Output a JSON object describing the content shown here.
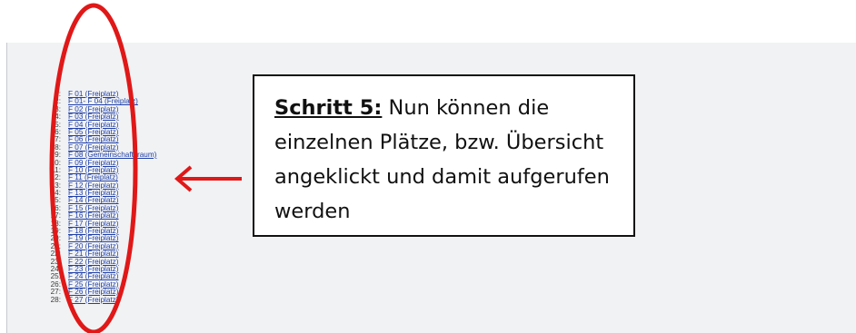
{
  "list": {
    "items": [
      {
        "num": "1:",
        "label": "F 01 (Freiplatz)"
      },
      {
        "num": "2:",
        "label": "F 01- F 04 (Freiplatz)"
      },
      {
        "num": "3:",
        "label": "F 02 (Freiplatz)"
      },
      {
        "num": "4:",
        "label": "F 03 (Freiplatz)"
      },
      {
        "num": "5:",
        "label": "F 04 (Freiplatz)"
      },
      {
        "num": "6:",
        "label": "F 05 (Freiplatz)"
      },
      {
        "num": "7:",
        "label": "F 06 (Freiplatz)"
      },
      {
        "num": "8:",
        "label": "F 07 (Freiplatz)"
      },
      {
        "num": "9:",
        "label": "F 08 (Gemeinschaftsraum)"
      },
      {
        "num": "10:",
        "label": "F 09 (Freiplatz)"
      },
      {
        "num": "11:",
        "label": "F 10 (Freiplatz)"
      },
      {
        "num": "12:",
        "label": "F 11 (Freiplatz)"
      },
      {
        "num": "13:",
        "label": "F 12 (Freiplatz)"
      },
      {
        "num": "14:",
        "label": "F 13 (Freiplatz)"
      },
      {
        "num": "15:",
        "label": "F 14 (Freiplatz)"
      },
      {
        "num": "16:",
        "label": "F 15 (Freiplatz)"
      },
      {
        "num": "17:",
        "label": "F 16 (Freiplatz)"
      },
      {
        "num": "18:",
        "label": "F 17 (Freiplatz)"
      },
      {
        "num": "19:",
        "label": "F 18 (Freiplatz)"
      },
      {
        "num": "20:",
        "label": "F 19 (Freiplatz)"
      },
      {
        "num": "21:",
        "label": "F 20 (Freiplatz)"
      },
      {
        "num": "22:",
        "label": "F 21 (Freiplatz)"
      },
      {
        "num": "23:",
        "label": "F 22 (Freiplatz)"
      },
      {
        "num": "24:",
        "label": "F 23 (Freiplatz)"
      },
      {
        "num": "25:",
        "label": "F 24 (Freiplatz)"
      },
      {
        "num": "26:",
        "label": "F 25 (Freiplatz)"
      },
      {
        "num": "27:",
        "label": "F 26 (Freiplatz)"
      },
      {
        "num": "28:",
        "label": "F 27 (Freiplatz)"
      }
    ]
  },
  "callout": {
    "step_label": "Schritt 5:",
    "text": " Nun können die einzelnen Plätze, bzw. Übersicht angeklickt und damit aufgerufen werden"
  },
  "annotation": {
    "highlight_color": "#e01818",
    "icons": [
      "red-ellipse-highlight",
      "red-arrow-left-icon"
    ]
  }
}
